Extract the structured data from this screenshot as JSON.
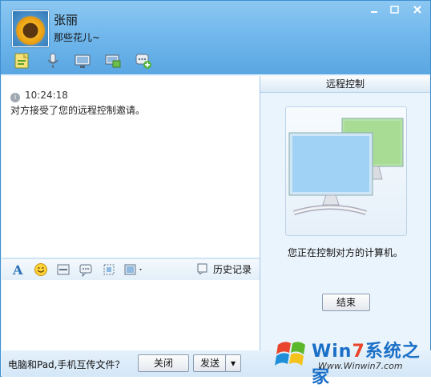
{
  "contact": {
    "name": "张丽",
    "status_message": "那些花儿~"
  },
  "window_controls": [
    "minimize-icon",
    "maximize-icon",
    "close-icon"
  ],
  "toolbar": {
    "icons": [
      "file-transfer-icon",
      "voice-call-icon",
      "video-call-icon",
      "remote-desktop-icon",
      "add-app-icon"
    ]
  },
  "chat": {
    "messages": [
      {
        "time": "10:24:18",
        "text": "对方接受了您的远程控制邀请。"
      }
    ]
  },
  "format_bar": {
    "icons": [
      "font-icon",
      "emoji-icon",
      "screenshot-icon",
      "bubble-icon",
      "capture-icon",
      "shake-icon"
    ],
    "history_label": "历史记录"
  },
  "bottom_bar": {
    "prompt": "电脑和Pad,手机互传文件？",
    "close_label": "关闭",
    "send_label": "发送",
    "send_dropdown": "▾"
  },
  "remote_panel": {
    "title": "远程控制",
    "status": "您正在控制对方的计算机。",
    "end_label": "结束"
  },
  "watermark": {
    "brand_prefix": "Win",
    "brand_digit": "7",
    "brand_suffix": "系统之家",
    "url": "Www.Winwin7.com"
  },
  "colors": {
    "header_top": "#8cc7f2",
    "header_bottom": "#5aa6e2",
    "border": "#3e8fd0",
    "panel_bg": "#eaf4fc"
  }
}
